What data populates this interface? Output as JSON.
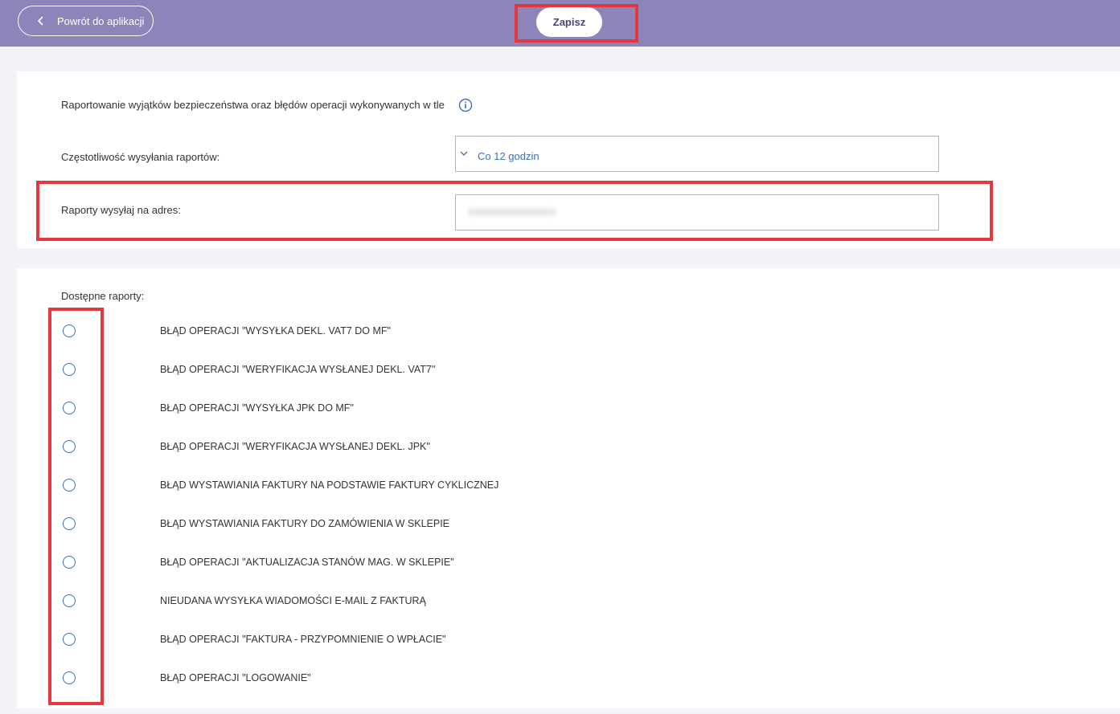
{
  "topbar": {
    "back_label": "Powrót do aplikacji",
    "save_label": "Zapisz",
    "background": "#8b85ba"
  },
  "settings": {
    "description": "Raportowanie wyjątków bezpieczeństwa oraz błędów operacji wykonywanych w tle",
    "frequency_label": "Częstotliwość wysyłania raportów:",
    "frequency_value": "Co 12 godzin",
    "address_label": "Raporty wysyłaj na adres:",
    "address_value": ""
  },
  "reports": {
    "heading": "Dostępne raporty:",
    "items": [
      {
        "label": "BŁĄD OPERACJI \"WYSYŁKA DEKL. VAT7 DO MF\"",
        "selected": false
      },
      {
        "label": "BŁĄD OPERACJI \"WERYFIKACJA WYSŁANEJ DEKL. VAT7\"",
        "selected": false
      },
      {
        "label": "BŁĄD OPERACJI \"WYSYŁKA JPK DO MF\"",
        "selected": false
      },
      {
        "label": "BŁĄD OPERACJI \"WERYFIKACJA WYSŁANEJ DEKL. JPK\"",
        "selected": false
      },
      {
        "label": "BŁĄD WYSTAWIANIA FAKTURY NA PODSTAWIE FAKTURY CYKLICZNEJ",
        "selected": false
      },
      {
        "label": "BŁĄD WYSTAWIANIA FAKTURY DO ZAMÓWIENIA W SKLEPIE",
        "selected": false
      },
      {
        "label": "BŁĄD OPERACJI \"AKTUALIZACJA STANÓW MAG. W SKLEPIE\"",
        "selected": false
      },
      {
        "label": "NIEUDANA WYSYŁKA WIADOMOŚCI E-MAIL Z FAKTURĄ",
        "selected": false
      },
      {
        "label": "BŁĄD OPERACJI \"FAKTURA - PRZYPOMNIENIE O WPŁACIE\"",
        "selected": false
      },
      {
        "label": "BŁĄD OPERACJI \"LOGOWANIE\"",
        "selected": false
      }
    ]
  },
  "colors": {
    "accent": "#3c6fb4",
    "highlight": "#e5383e"
  }
}
